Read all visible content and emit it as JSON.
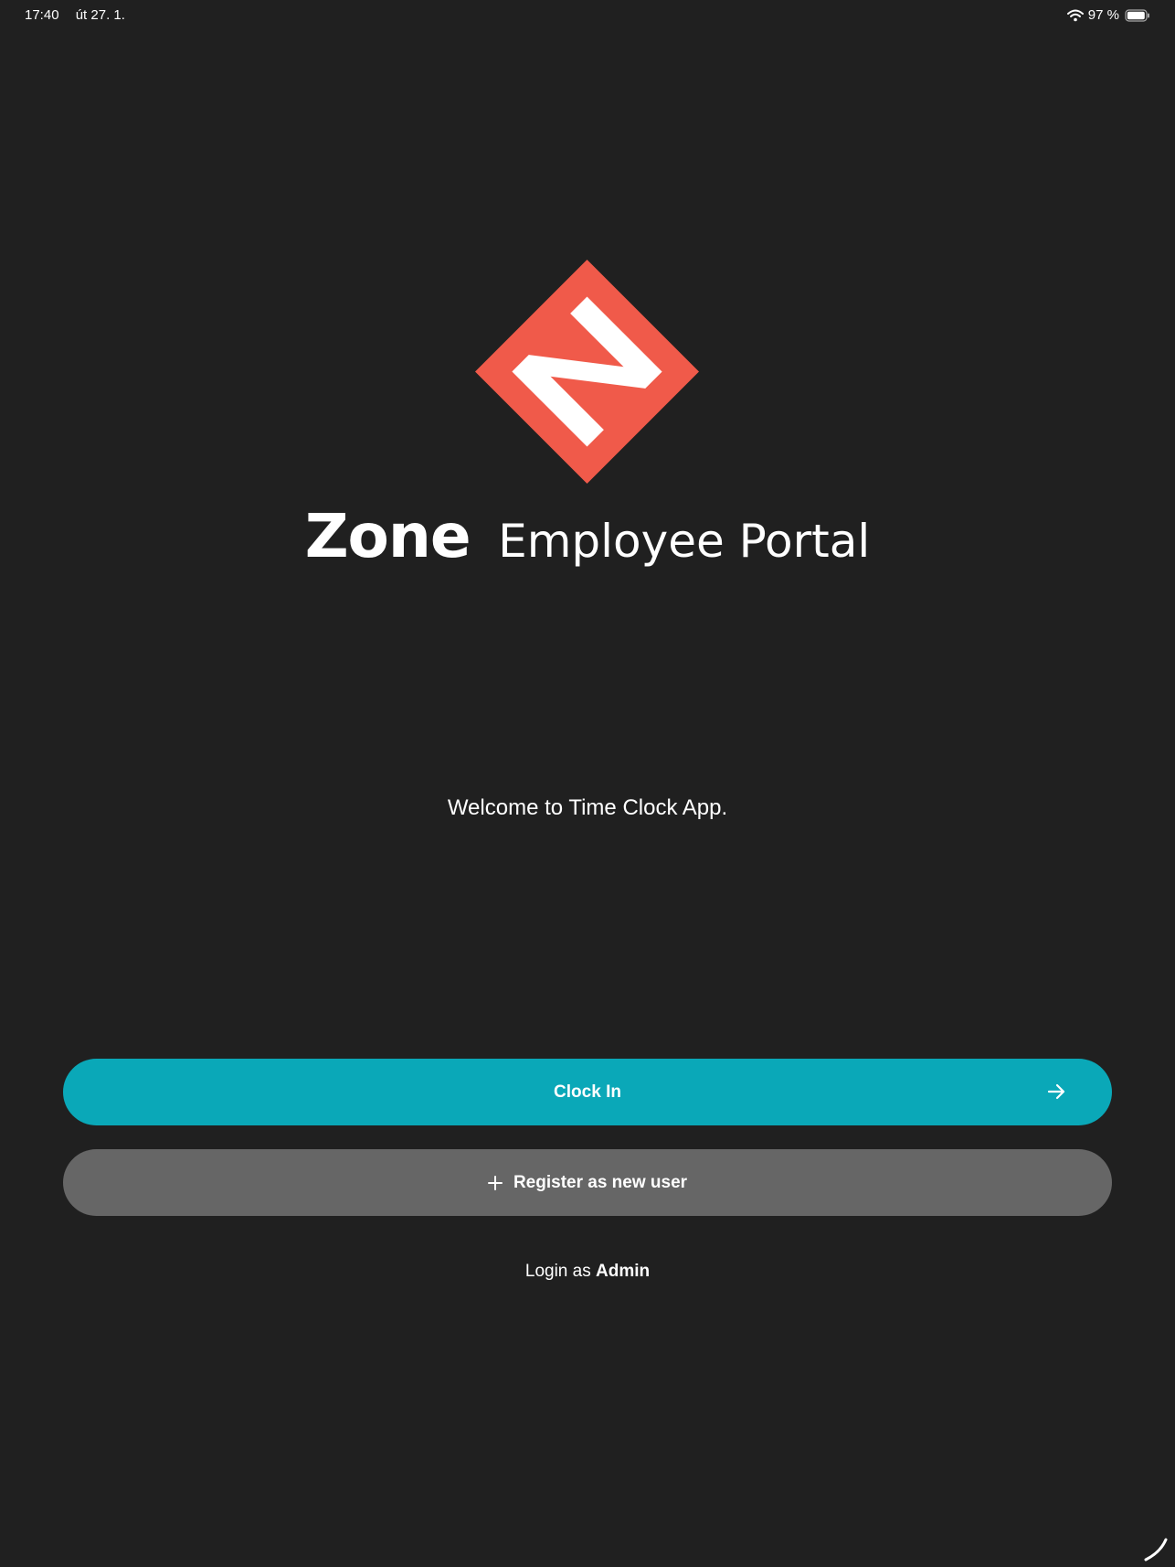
{
  "status_bar": {
    "time": "17:40",
    "date": "út 27. 1.",
    "battery": "97 %",
    "icons": [
      "wifi-icon",
      "battery-icon"
    ]
  },
  "brand": {
    "logo_letter": "N",
    "name": "Zone",
    "subtitle": "Employee Portal",
    "logo_color": "#f05a4a"
  },
  "welcome_text": "Welcome to Time Clock App.",
  "buttons": {
    "clock_in": {
      "label": "Clock In",
      "icon": "arrow-right-icon",
      "color": "#0aa8b8"
    },
    "register": {
      "label": "Register as new user",
      "icon": "plus-icon",
      "color": "#666666"
    }
  },
  "admin_login": {
    "prefix": "Login as",
    "link": "Admin"
  }
}
